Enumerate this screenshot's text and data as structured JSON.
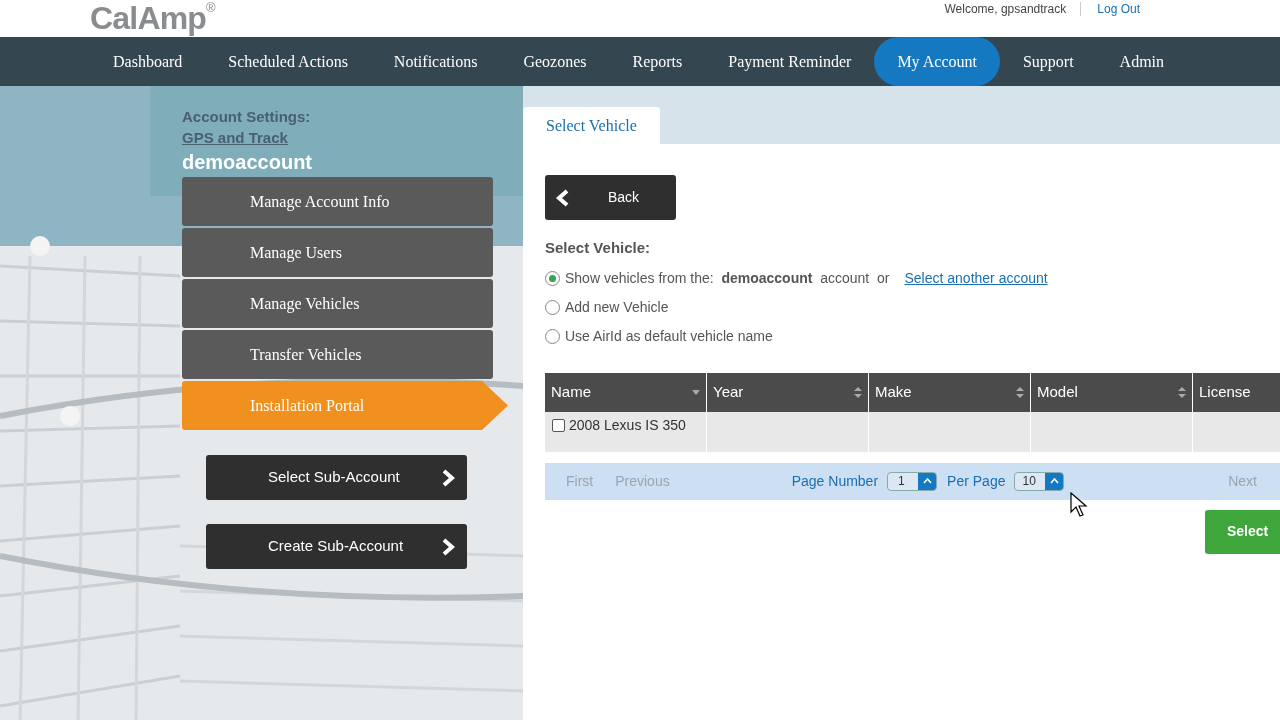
{
  "header": {
    "logo": "CalAmp",
    "logo_mark": "®",
    "welcome": "Welcome, gpsandtrack",
    "logout": "Log Out"
  },
  "nav": [
    {
      "label": "Dashboard",
      "selected": false
    },
    {
      "label": "Scheduled Actions",
      "selected": false
    },
    {
      "label": "Notifications",
      "selected": false
    },
    {
      "label": "Geozones",
      "selected": false
    },
    {
      "label": "Reports",
      "selected": false
    },
    {
      "label": "Payment Reminder",
      "selected": false
    },
    {
      "label": "My Account",
      "selected": true
    },
    {
      "label": "Support",
      "selected": false
    },
    {
      "label": "Admin",
      "selected": false
    }
  ],
  "sidebar": {
    "heading": "Account Settings:",
    "company_link": "GPS and Track",
    "account": "demoaccount",
    "menu": [
      {
        "label": "Manage Account Info",
        "selected": false
      },
      {
        "label": "Manage Users",
        "selected": false
      },
      {
        "label": "Manage Vehicles",
        "selected": false
      },
      {
        "label": "Transfer Vehicles",
        "selected": false
      },
      {
        "label": "Installation Portal",
        "selected": true
      }
    ],
    "actions": [
      "Select Sub-Account",
      "Create Sub-Account"
    ]
  },
  "panel": {
    "tab": {
      "label": "Select Vehicle",
      "selected": true
    },
    "back": "Back",
    "title": "Select Vehicle:",
    "options": [
      {
        "label": "Show vehicles from the:  **demoaccount**  account  or",
        "link": "Select another account",
        "selected": true
      },
      {
        "label": "Add new Vehicle",
        "selected": false
      },
      {
        "label": "Use AirId as default vehicle name",
        "selected": false
      }
    ],
    "columns": [
      {
        "label": "Name",
        "kind": "sort_down"
      },
      {
        "label": "Year",
        "kind": "sortable"
      },
      {
        "label": "Make",
        "kind": "sortable"
      },
      {
        "label": "Model",
        "kind": "sortable"
      },
      {
        "label": "License",
        "kind": "plain"
      }
    ],
    "rows": [
      {
        "name": "2008 Lexus IS 350",
        "checked": false
      }
    ],
    "pager": {
      "first": "First",
      "previous": "Previous",
      "page_label": "Page Number",
      "page": "1",
      "per_page_label": "Per Page",
      "per_page": "10",
      "next": "Next"
    },
    "select": "Select"
  }
}
